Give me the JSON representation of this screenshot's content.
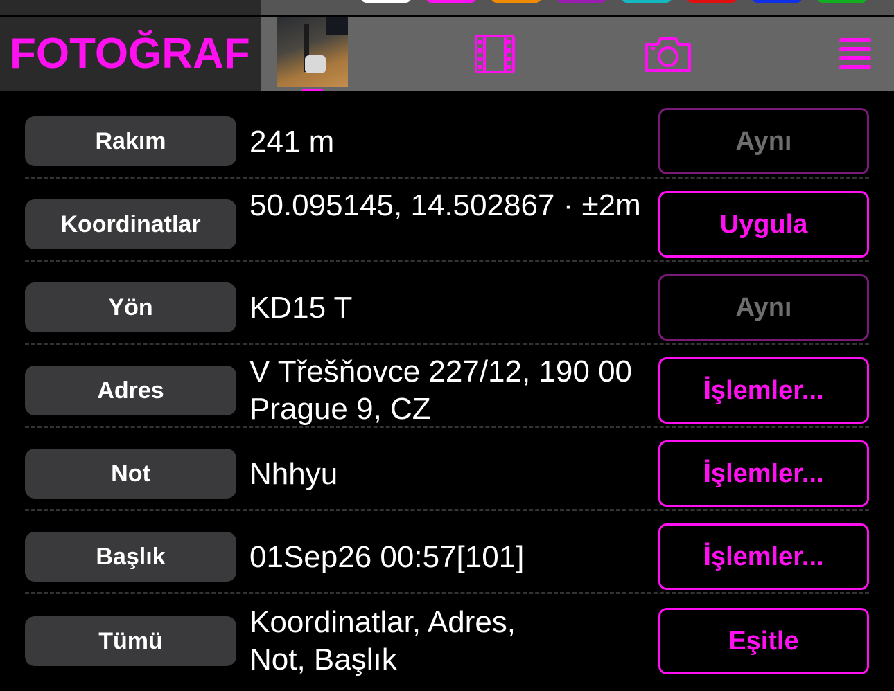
{
  "app": {
    "title": "FOTOĞRAF"
  },
  "colors": {
    "accent": "#ff10f0",
    "accent_dim": "#7a1a76",
    "label_bg": "#3a3a3c",
    "background": "#000000",
    "toolbar_bg": "#666666"
  },
  "toolbar": {
    "icons": [
      "film-strip-icon",
      "camera-icon",
      "hamburger-menu-icon"
    ]
  },
  "rows": [
    {
      "label": "Rakım",
      "value": "241 m",
      "action": "Aynı",
      "action_enabled": false
    },
    {
      "label": "Koordinatlar",
      "value": "50.095145, 14.502867 · ±2m",
      "action": "Uygula",
      "action_enabled": true
    },
    {
      "label": "Yön",
      "value": "KD15 T",
      "action": "Aynı",
      "action_enabled": false
    },
    {
      "label": "Adres",
      "value": "V Třešňovce 227/12, 190 00 Prague 9, CZ",
      "action": "İşlemler...",
      "action_enabled": true
    },
    {
      "label": "Not",
      "value": "Nhhyu",
      "action": "İşlemler...",
      "action_enabled": true
    },
    {
      "label": "Başlık",
      "value": "01Sep26 00:57[101]",
      "action": "İşlemler...",
      "action_enabled": true
    },
    {
      "label": "Tümü",
      "value": "Koordinatlar, Adres, Not, Başlık",
      "action": "Eşitle",
      "action_enabled": true
    }
  ]
}
